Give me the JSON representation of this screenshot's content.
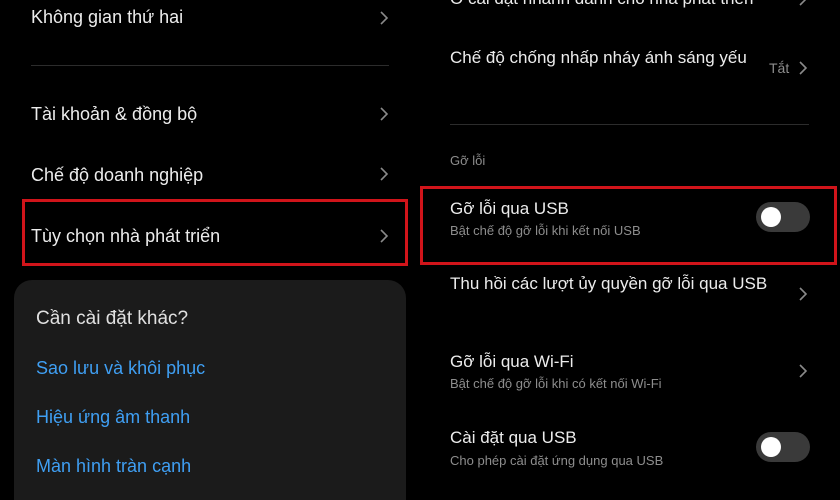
{
  "left": {
    "items": [
      {
        "label": "Không gian thứ hai"
      },
      {
        "label": "Tài khoản & đồng bộ"
      },
      {
        "label": "Chế độ doanh nghiệp"
      },
      {
        "label": "Tùy chọn nhà phát triển"
      }
    ],
    "card": {
      "title": "Cần cài đặt khác?",
      "links": [
        "Sao lưu và khôi phục",
        "Hiệu ứng âm thanh",
        "Màn hình tràn cạnh"
      ]
    }
  },
  "right": {
    "partial_top_item": "Ô cài đặt nhanh dành cho nhà phát triển",
    "flicker": {
      "title": "Chế độ chống nhấp nháy ánh sáng yếu",
      "value": "Tắt"
    },
    "section": "Gỡ lỗi",
    "usb_debug": {
      "title": "Gỡ lỗi qua USB",
      "subtitle": "Bật chế độ gỡ lỗi khi kết nối USB",
      "enabled": false
    },
    "revoke": {
      "title": "Thu hồi các lượt ủy quyền gỡ lỗi qua USB"
    },
    "wifi_debug": {
      "title": "Gỡ lỗi qua Wi-Fi",
      "subtitle": "Bật chế độ gỡ lỗi khi có kết nối Wi-Fi"
    },
    "usb_install": {
      "title": "Cài đặt qua USB",
      "subtitle": "Cho phép cài đặt ứng dụng qua USB",
      "enabled": false
    }
  },
  "colors": {
    "highlight": "#d0141a",
    "link": "#3f9ff3",
    "background": "#000000"
  }
}
